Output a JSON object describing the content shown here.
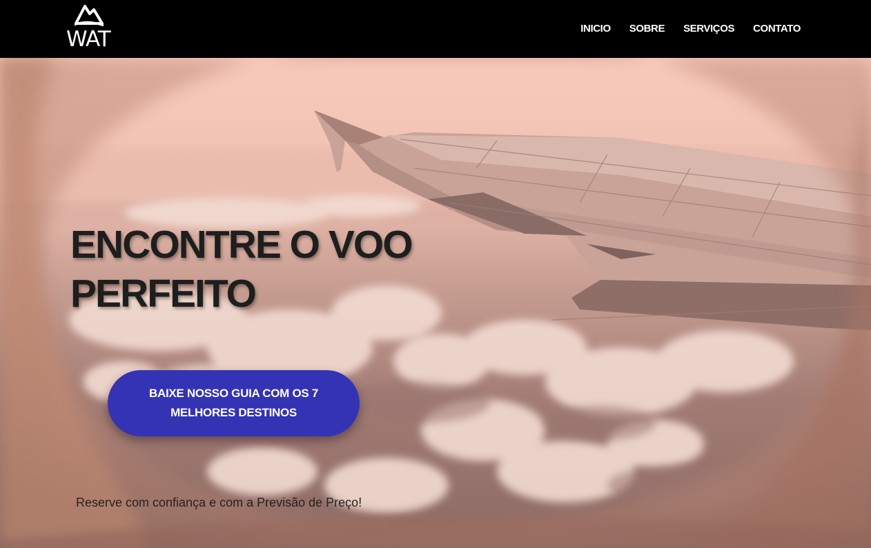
{
  "header": {
    "logo_text": "WAT",
    "nav": [
      {
        "label": "INICIO"
      },
      {
        "label": "SOBRE"
      },
      {
        "label": "SERVIÇOS"
      },
      {
        "label": "CONTATO"
      }
    ]
  },
  "hero": {
    "headline_line1": "ENCONTRE O VOO",
    "headline_line2": "PERFEITO",
    "cta_label": "BAIXE NOSSO GUIA COM OS 7 MELHORES DESTINOS",
    "tagline": "Reserve com confiança e com a Previsão de Preço!"
  },
  "colors": {
    "header_bg": "#000000",
    "cta_bg": "#3433b4",
    "hero_tint": "#f6c6b6"
  },
  "icons": {
    "logo": "mountain-logo-icon"
  }
}
